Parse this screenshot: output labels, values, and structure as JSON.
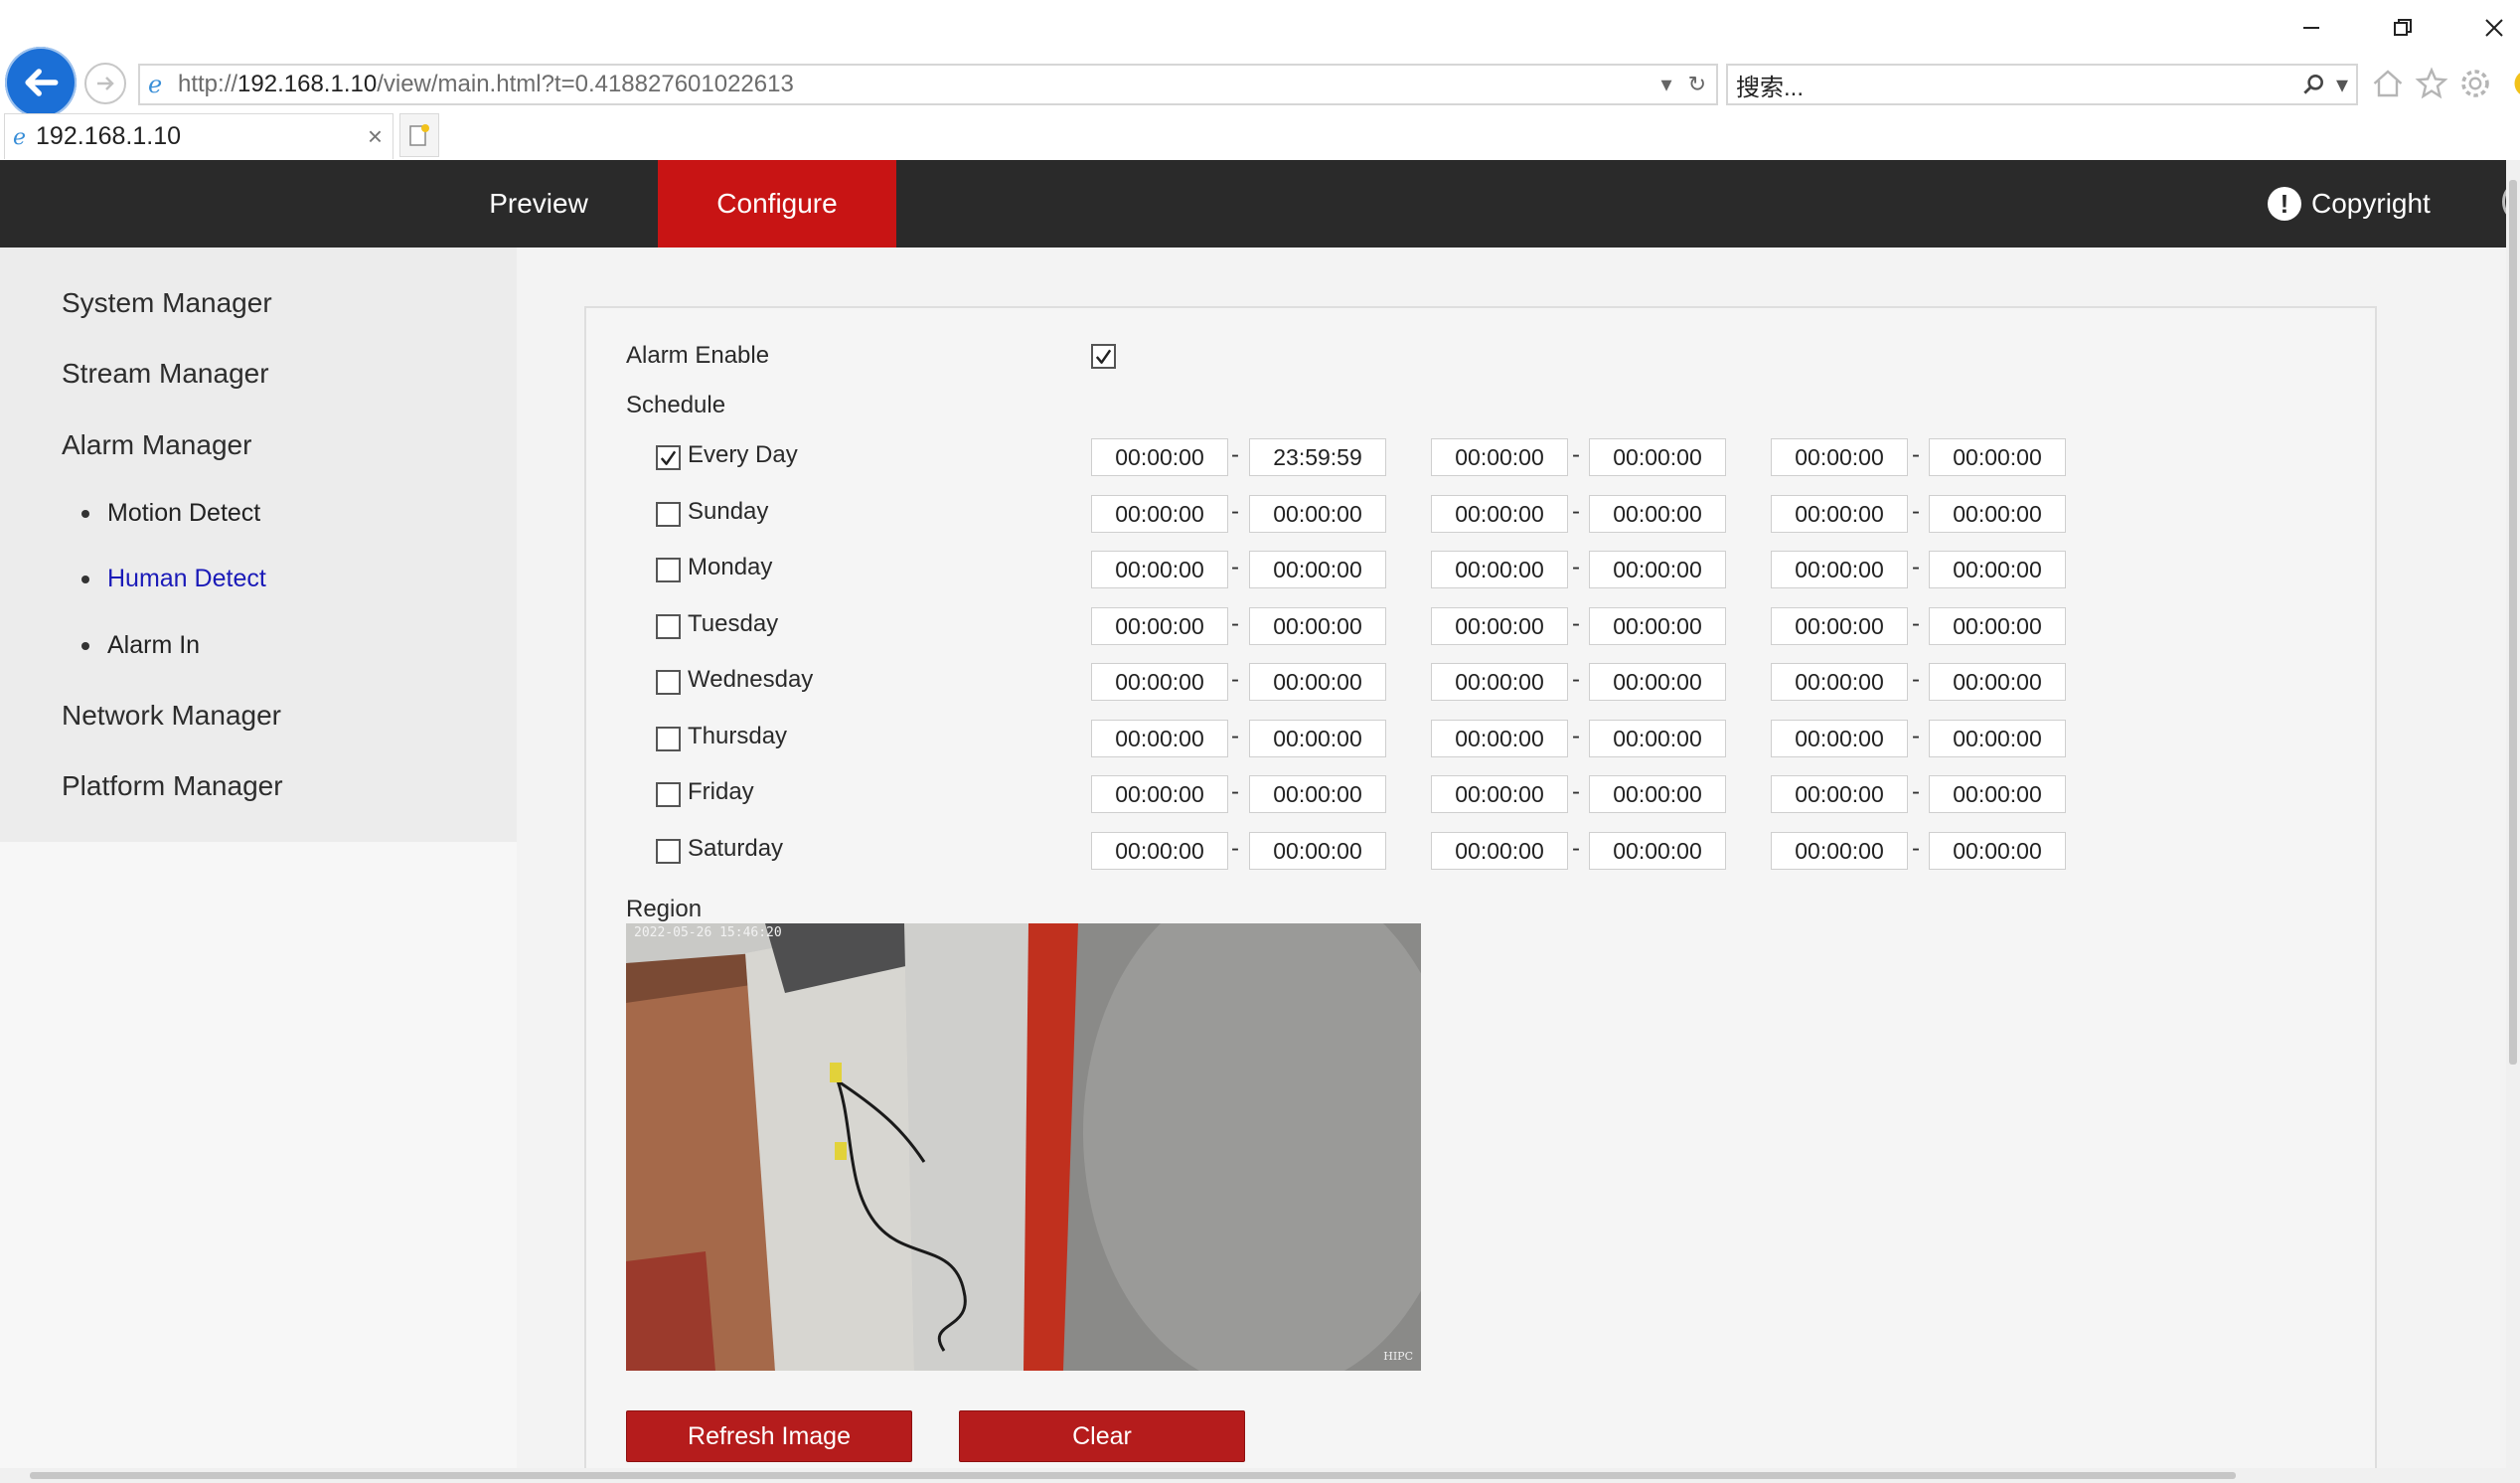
{
  "browser": {
    "url_prefix": "http://",
    "url_host": "192.168.1.10",
    "url_path": "/view/main.html?t=0.418827601022613",
    "search_placeholder": "搜索...",
    "tab_title": "192.168.1.10",
    "tab_close": "×"
  },
  "header": {
    "tabs": [
      {
        "label": "Preview"
      },
      {
        "label": "Configure"
      }
    ],
    "copyright": "Copyright",
    "accent_color": "#c81414"
  },
  "sidebar": {
    "items": [
      {
        "label": "System Manager"
      },
      {
        "label": "Stream Manager"
      },
      {
        "label": "Alarm Manager"
      },
      {
        "label": "Network Manager"
      },
      {
        "label": "Platform Manager"
      }
    ],
    "subitems": [
      {
        "label": "Motion Detect"
      },
      {
        "label": "Human Detect"
      },
      {
        "label": "Alarm In"
      }
    ]
  },
  "form": {
    "alarm_enable_label": "Alarm Enable",
    "alarm_enabled": true,
    "schedule_label": "Schedule",
    "region_label": "Region",
    "days": [
      {
        "label": "Every Day",
        "checked": true,
        "times": [
          "00:00:00",
          "23:59:59",
          "00:00:00",
          "00:00:00",
          "00:00:00",
          "00:00:00"
        ]
      },
      {
        "label": "Sunday",
        "checked": false,
        "times": [
          "00:00:00",
          "00:00:00",
          "00:00:00",
          "00:00:00",
          "00:00:00",
          "00:00:00"
        ]
      },
      {
        "label": "Monday",
        "checked": false,
        "times": [
          "00:00:00",
          "00:00:00",
          "00:00:00",
          "00:00:00",
          "00:00:00",
          "00:00:00"
        ]
      },
      {
        "label": "Tuesday",
        "checked": false,
        "times": [
          "00:00:00",
          "00:00:00",
          "00:00:00",
          "00:00:00",
          "00:00:00",
          "00:00:00"
        ]
      },
      {
        "label": "Wednesday",
        "checked": false,
        "times": [
          "00:00:00",
          "00:00:00",
          "00:00:00",
          "00:00:00",
          "00:00:00",
          "00:00:00"
        ]
      },
      {
        "label": "Thursday",
        "checked": false,
        "times": [
          "00:00:00",
          "00:00:00",
          "00:00:00",
          "00:00:00",
          "00:00:00",
          "00:00:00"
        ]
      },
      {
        "label": "Friday",
        "checked": false,
        "times": [
          "00:00:00",
          "00:00:00",
          "00:00:00",
          "00:00:00",
          "00:00:00",
          "00:00:00"
        ]
      },
      {
        "label": "Saturday",
        "checked": false,
        "times": [
          "00:00:00",
          "00:00:00",
          "00:00:00",
          "00:00:00",
          "00:00:00",
          "00:00:00"
        ]
      }
    ],
    "dash": "-"
  },
  "video": {
    "timestamp": "2022-05-26 15:46:20",
    "watermark": "HIPC"
  },
  "buttons": {
    "refresh": "Refresh Image",
    "clear": "Clear",
    "color": "#b51c1c"
  }
}
